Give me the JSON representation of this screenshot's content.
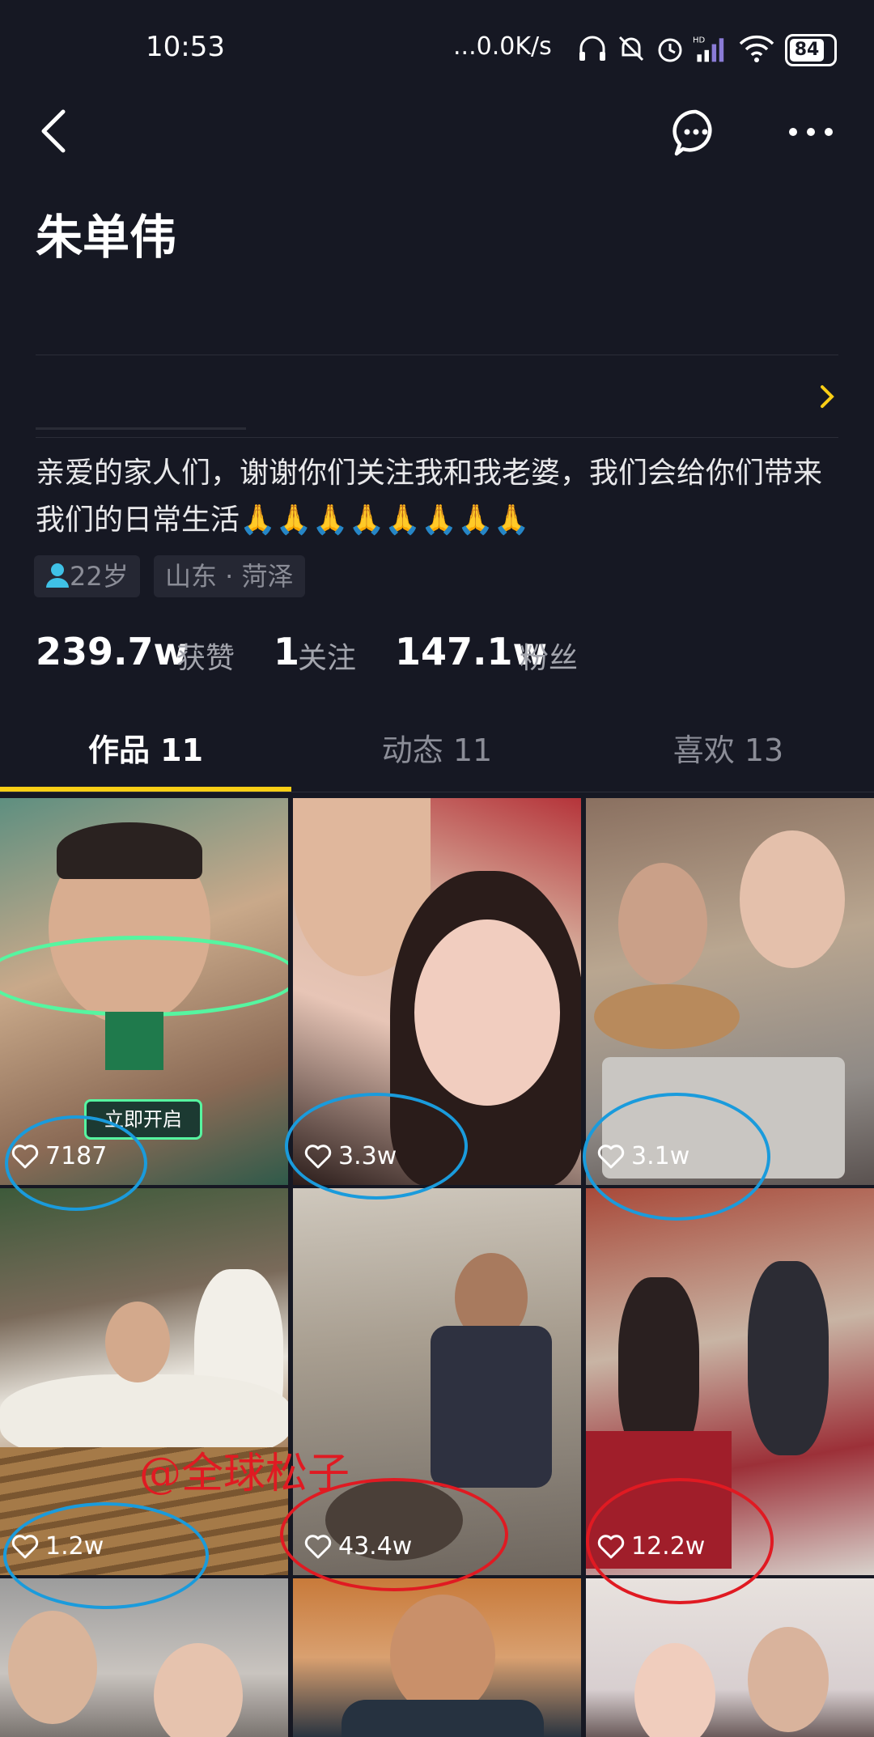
{
  "status_bar": {
    "time": "10:53",
    "network_speed": "...0.0K/s",
    "battery": "84",
    "signal_label": "HD"
  },
  "header": {
    "back_icon": "chevron-left-icon",
    "chat_icon": "chat-bubble-icon",
    "more_icon": "more-dots-icon"
  },
  "profile": {
    "name": "朱单伟",
    "bio": "亲爱的家人们，谢谢你们关注我和我老婆，我们会给你们带来我们的日常生活🙏🙏🙏🙏🙏🙏🙏🙏",
    "age": "22岁",
    "location": "山东 · 菏泽"
  },
  "stats": [
    {
      "value": "239.7w",
      "label": "获赞"
    },
    {
      "value": "1",
      "label": "关注"
    },
    {
      "value": "147.1w",
      "label": "粉丝"
    }
  ],
  "tabs": [
    {
      "label": "作品 11",
      "active": true
    },
    {
      "label": "动态 11",
      "active": false
    },
    {
      "label": "喜欢 13",
      "active": false
    }
  ],
  "videos": [
    {
      "likes": "7187",
      "circle": "blue"
    },
    {
      "likes": "3.3w",
      "circle": "blue"
    },
    {
      "likes": "3.1w",
      "circle": "blue"
    },
    {
      "likes": "1.2w",
      "circle": "blue"
    },
    {
      "likes": "43.4w",
      "circle": "red"
    },
    {
      "likes": "12.2w",
      "circle": "red"
    },
    {
      "likes": ""
    },
    {
      "likes": ""
    },
    {
      "likes": ""
    }
  ],
  "overlay": {
    "watermark": "@全球松子",
    "thumb1_badge": "立即开启"
  },
  "colors": {
    "background": "#161823",
    "accent": "#face15",
    "annotation_blue": "#1a9bdc",
    "annotation_red": "#e01a22"
  }
}
